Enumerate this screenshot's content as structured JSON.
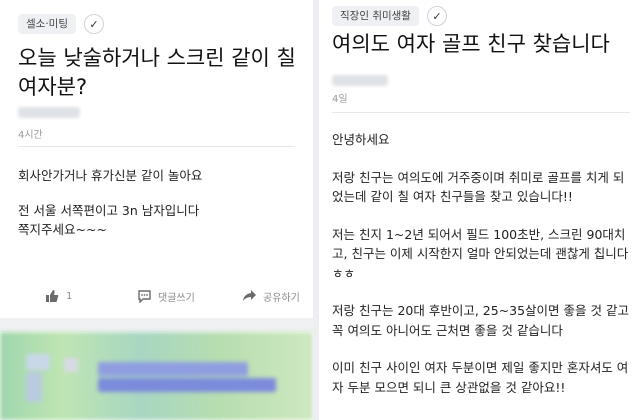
{
  "left_post": {
    "tag": "셀소·미팅",
    "title": "오늘 낮술하거나 스크린 같이 칠 여자분?",
    "time": "4시간",
    "body": [
      "회사안가거나 휴가신분 같이 놀아요",
      "전 서울 서쪽편이고 3n 남자입니다\n쪽지주세요~~~"
    ],
    "actions": {
      "like_count": "1",
      "comment_label": "댓글쓰기",
      "share_label": "공유하기"
    }
  },
  "right_post": {
    "tag": "직장인 취미생활",
    "title": "여의도 여자 골프 친구 찾습니다",
    "time": "4일",
    "body": [
      "안녕하세요",
      "저랑 친구는 여의도에 거주중이며 취미로 골프를 치게 되었는데 같이 칠 여자 친구들을 찾고 있습니다!!",
      "저는 친지 1~2년 되어서 필드 100초반, 스크린 90대치고, 친구는 이제 시작한지 얼마 안되었는데 괜찮게 칩니다 ㅎㅎ",
      "저랑 친구는 20대 후반이고, 25~35살이면 좋을 것 같고 꼭 여의도 아니어도 근처면 좋을 것 같습니다",
      "이미 친구 사이인 여자 두분이면 제일 좋지만 혼자셔도 여자 두분 모으면 되니 큰 상관없을 것 같아요!!"
    ]
  },
  "icons": {
    "verified": "check-icon",
    "like": "thumbs-up-icon",
    "comment": "comment-icon",
    "share": "share-arrow-icon"
  },
  "colors": {
    "tag_bg": "#eef0f3",
    "meta_text": "#9a9a9a",
    "divider": "#eceef1"
  }
}
